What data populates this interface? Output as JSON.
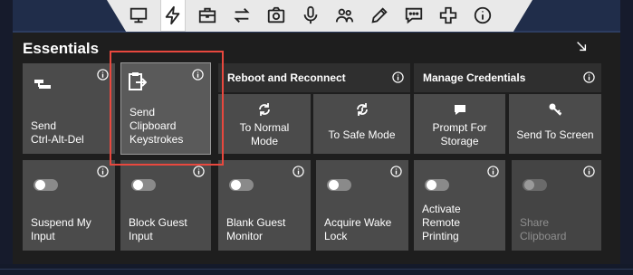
{
  "toolbar": {
    "icons": [
      "monitor-icon",
      "lightning-icon",
      "briefcase-icon",
      "swap-arrows-icon",
      "camera-icon",
      "microphone-icon",
      "users-icon",
      "pencil-icon",
      "chat-icon",
      "plus-icon",
      "info-icon"
    ],
    "active": "lightning-icon"
  },
  "panel": {
    "title": "Essentials"
  },
  "tiles": {
    "ctrl_alt_del": "Send\nCtrl-Alt-Del",
    "clipboard_keystrokes": "Send\nClipboard\nKeystrokes",
    "reboot_section": "Reboot and Reconnect",
    "normal_mode": "To Normal\nMode",
    "safe_mode": "To Safe Mode",
    "credentials_section": "Manage Credentials",
    "prompt_storage": "Prompt For\nStorage",
    "send_screen": "Send To Screen",
    "suspend_input": "Suspend My\nInput",
    "block_guest": "Block Guest\nInput",
    "blank_monitor": "Blank Guest\nMonitor",
    "wake_lock": "Acquire Wake\nLock",
    "remote_printing": "Activate\nRemote\nPrinting",
    "share_clipboard": "Share\nClipboard"
  },
  "colors": {
    "accent_highlight": "#e8483e",
    "tile": "#4b4b4b",
    "panel": "#1e1e1e",
    "toolbar": "#e9e9e9"
  }
}
